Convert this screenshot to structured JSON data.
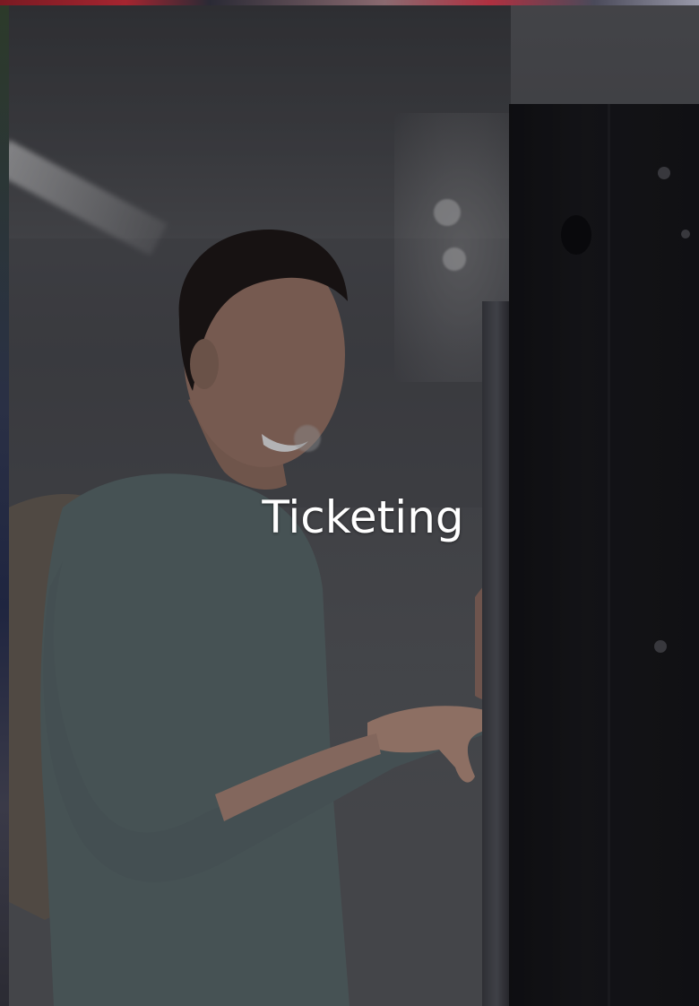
{
  "card": {
    "title": "Ticketing"
  },
  "colors": {
    "title_text": "#ffffff",
    "overlay": "#1e1e22",
    "machine": "#111113",
    "accent_strip": "#a52530"
  },
  "icons": []
}
